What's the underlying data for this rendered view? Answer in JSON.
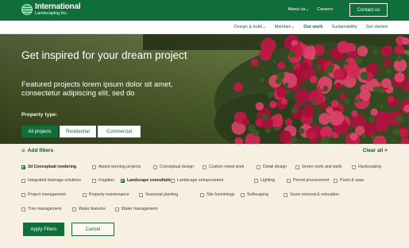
{
  "brand": {
    "name": "International",
    "sub": "Landscaping Inc."
  },
  "top_nav": {
    "about": "About us",
    "careers": "Careers",
    "contact": "Contact us"
  },
  "sub_nav": [
    "Design & build",
    "Maintain",
    "Our work",
    "Sustainability",
    "Get started"
  ],
  "hero": {
    "title": "Get inspired for your dream project",
    "subtitle": "Featured projects lorem ipsum dolor sit amet, consectetur adipiscing elit, sed do",
    "property_label": "Property type:",
    "property_types": [
      {
        "label": "All projects",
        "selected": true
      },
      {
        "label": "Residential",
        "selected": false
      },
      {
        "label": "Commercial",
        "selected": false
      }
    ]
  },
  "filters": {
    "add_label": "Add filters",
    "clear_label": "Clear all",
    "options": [
      {
        "label": "3d Conceptual rendering",
        "checked": true
      },
      {
        "label": "Award winning projects",
        "checked": false
      },
      {
        "label": "Conceptual design",
        "checked": false
      },
      {
        "label": "Custom metal work",
        "checked": false
      },
      {
        "label": "Detail design",
        "checked": false
      },
      {
        "label": "Green roofs and walls",
        "checked": false
      },
      {
        "label": "Hardscaping",
        "checked": false
      },
      {
        "label": "Integrated drainage solutions",
        "checked": false
      },
      {
        "label": "Irrigation",
        "checked": false
      },
      {
        "label": "Landscape consultation",
        "checked": true
      },
      {
        "label": "Landscape enhancement",
        "checked": false
      },
      {
        "label": "Lighting",
        "checked": false
      },
      {
        "label": "Permit procurement",
        "checked": false
      },
      {
        "label": "Pools & spas",
        "checked": false
      },
      {
        "label": "Project management",
        "checked": false
      },
      {
        "label": "Property maintenance",
        "checked": false
      },
      {
        "label": "Seasonal planting",
        "checked": false
      },
      {
        "label": "Site furnishings",
        "checked": false
      },
      {
        "label": "Softscaping",
        "checked": false
      },
      {
        "label": "Snow  removal & relocation",
        "checked": false
      },
      {
        "label": "Tree management",
        "checked": false
      },
      {
        "label": "Water features",
        "checked": false
      },
      {
        "label": "Water management",
        "checked": false
      }
    ],
    "apply_label": "Apply Filters",
    "cancel_label": "Cancel"
  },
  "colors": {
    "brand_green": "#0f6e3a",
    "panel_bg": "#f7efe1",
    "flower_red": "#c8194a"
  }
}
